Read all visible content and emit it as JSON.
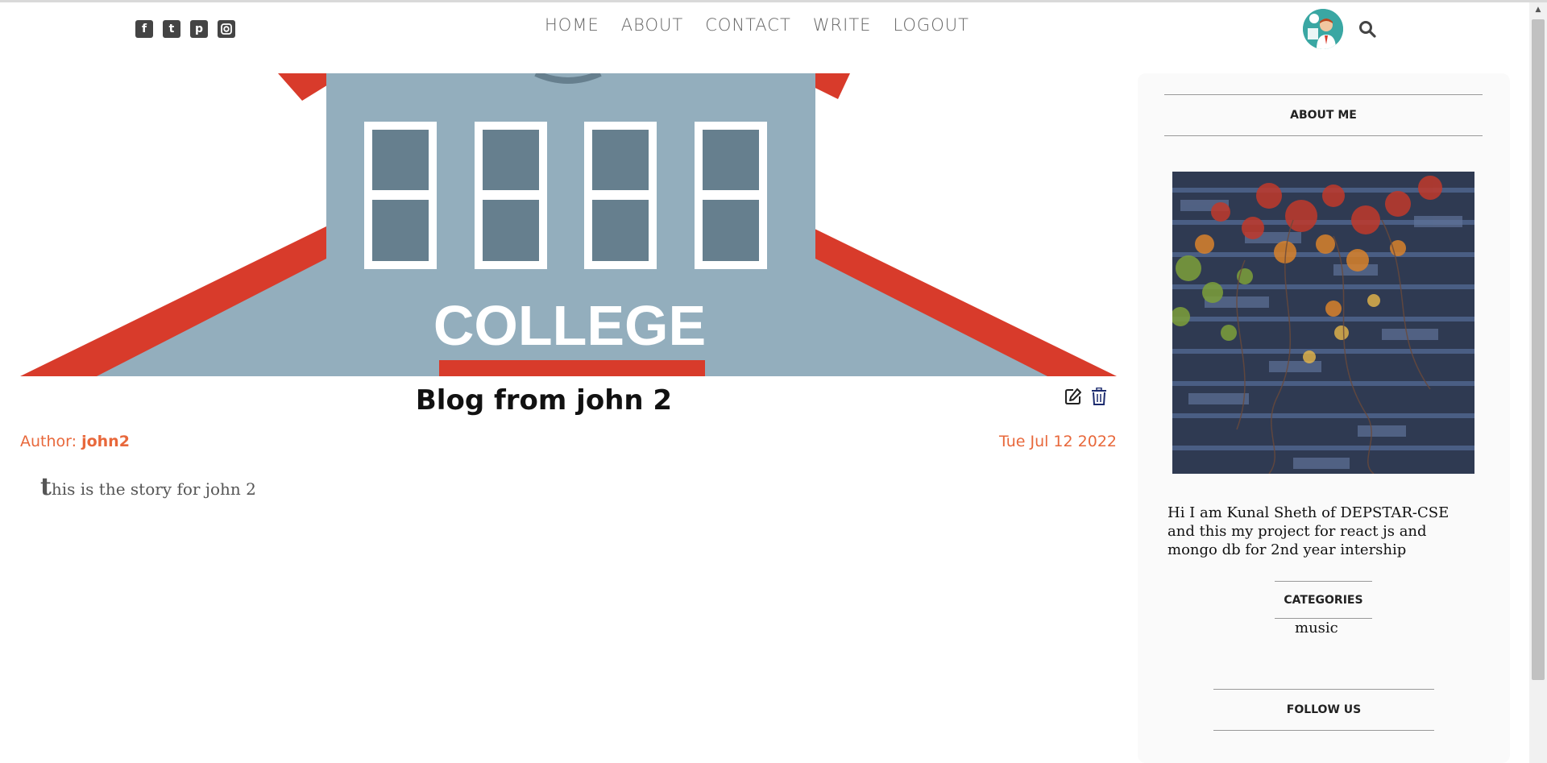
{
  "social_icons": [
    "facebook-icon",
    "twitter-icon",
    "pinterest-icon",
    "instagram-icon"
  ],
  "nav": {
    "items": [
      "HOME",
      "ABOUT",
      "CONTACT",
      "WRITE",
      "LOGOUT"
    ]
  },
  "hero": {
    "banner_text": "COLLEGE"
  },
  "post": {
    "title": "Blog from john 2",
    "author_label": "Author:",
    "author_name": "john2",
    "date": "Tue Jul 12 2022",
    "body_first_letter": "t",
    "body_rest": "his is the story for john 2"
  },
  "sidebar": {
    "about_title": "ABOUT ME",
    "about_text": "Hi I am Kunal Sheth of DEPSTAR-CSE and this my project for react js and mongo db for 2nd year intership",
    "categories_title": "CATEGORIES",
    "categories": [
      "music"
    ],
    "follow_title": "FOLLOW US"
  },
  "colors": {
    "accent": "#e8683b",
    "roof": "#d83b2b",
    "building": "#93aebd",
    "window": "#667f8e"
  }
}
